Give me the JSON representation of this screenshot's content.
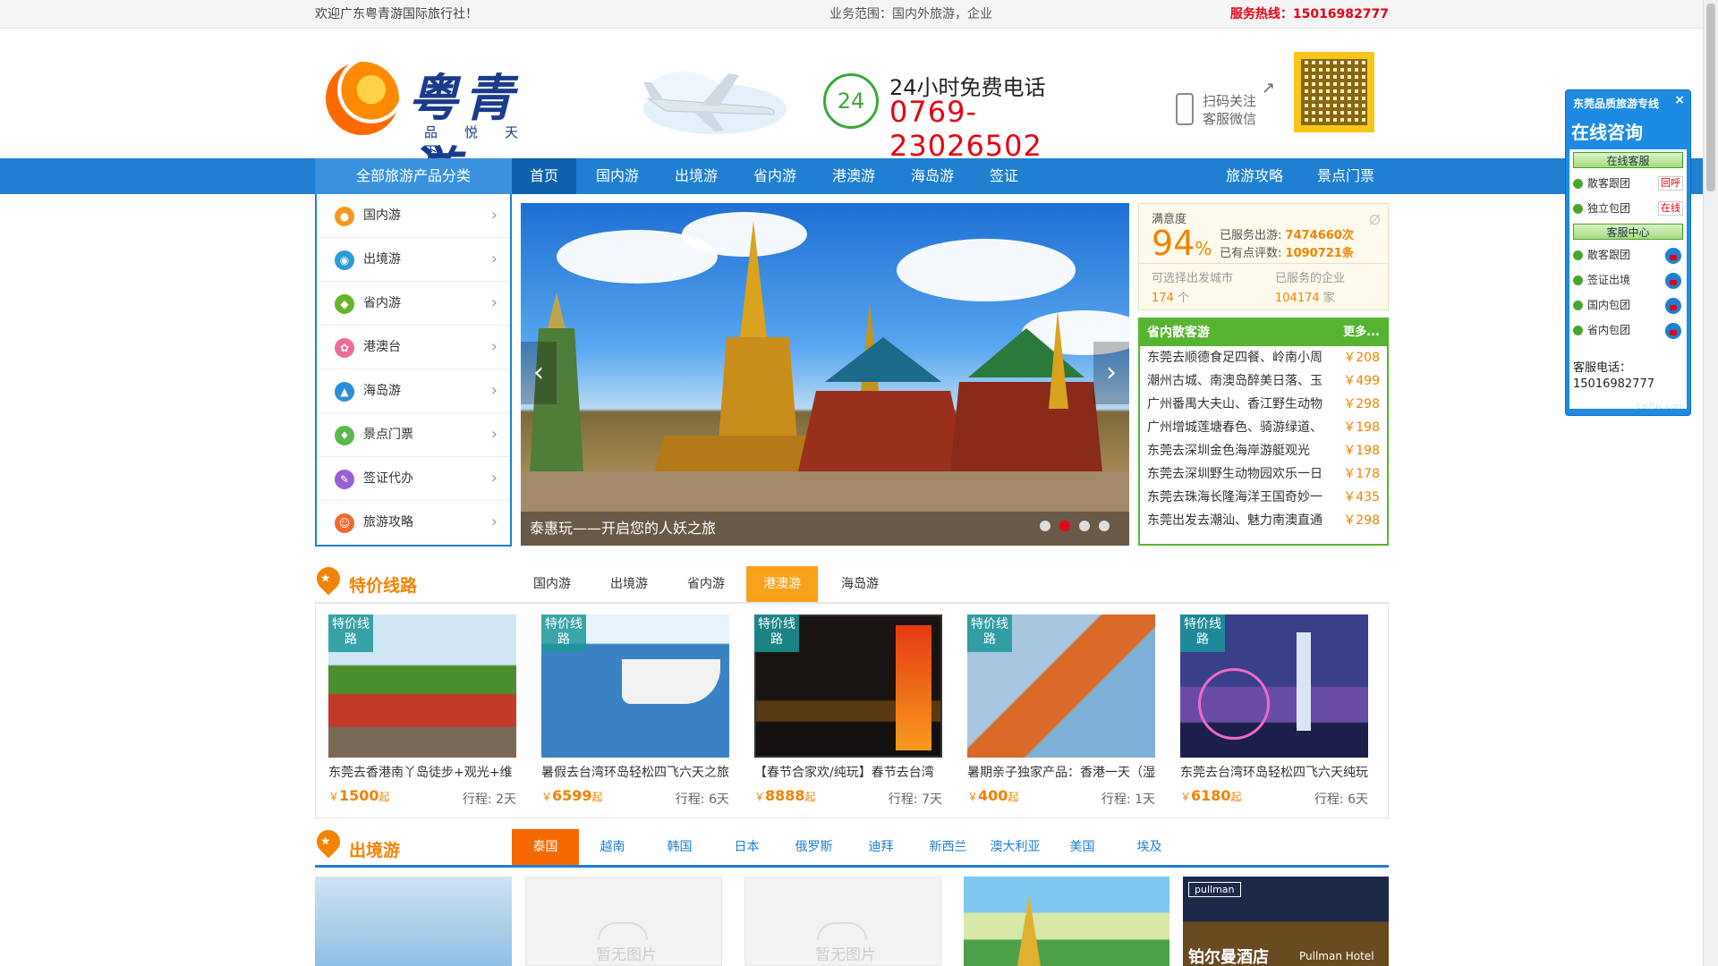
{
  "topbar": {
    "welcome": "欢迎广东粤青游国际旅行社！",
    "scope": "业务范围：国内外旅游，企业",
    "hotline": "服务热线：15016982777"
  },
  "header": {
    "logo_title": "粤青游",
    "logo_slogan": "品悦天下",
    "phone_ring": "24",
    "phone_label": "24小时免费电话",
    "phone_number": "0769-23026502",
    "scan_line1": "扫码关注",
    "scan_line2": "客服微信"
  },
  "nav": {
    "all_label": "全部旅游产品分类",
    "items": [
      {
        "label": "首页",
        "active": true
      },
      {
        "label": "国内游"
      },
      {
        "label": "出境游"
      },
      {
        "label": "省内游"
      },
      {
        "label": "港澳游"
      },
      {
        "label": "海岛游"
      },
      {
        "label": "签证"
      },
      {
        "label": "旅游攻略"
      },
      {
        "label": "景点门票"
      }
    ]
  },
  "categories": [
    {
      "label": "国内游",
      "icon": "domestic-icon",
      "color": "#f39a1e"
    },
    {
      "label": "出境游",
      "icon": "globe-icon",
      "color": "#2d9ad8"
    },
    {
      "label": "省内游",
      "icon": "location-icon",
      "color": "#6ab22d"
    },
    {
      "label": "港澳台",
      "icon": "hk-macau-icon",
      "color": "#f06b9a"
    },
    {
      "label": "海岛游",
      "icon": "island-icon",
      "color": "#2d8ed8"
    },
    {
      "label": "景点门票",
      "icon": "ticket-icon",
      "color": "#5bb84a"
    },
    {
      "label": "签证代办",
      "icon": "visa-icon",
      "color": "#9a5fd0"
    },
    {
      "label": "旅游攻略",
      "icon": "guide-icon",
      "color": "#f26a2d"
    }
  ],
  "banner": {
    "caption": "泰惠玩——开启您的人妖之旅",
    "prev": "‹",
    "next": "›",
    "dots": 4,
    "active_dot": 1
  },
  "stats": {
    "satisfaction_label": "满意度",
    "satisfaction_value": "94",
    "satisfaction_unit": "%",
    "served_label": "已服务出游:",
    "served_value": "7474660次",
    "reviews_label": "已有点评数:",
    "reviews_value": "1090721条",
    "cities_label": "可选择出发城市",
    "cities_value": "174",
    "cities_unit": "个",
    "companies_label": "已服务的企业",
    "companies_value": "104174",
    "companies_unit": "家"
  },
  "province_tours": {
    "title": "省内散客游",
    "more": "更多...",
    "items": [
      {
        "title": "东莞去顺德食足四餐、岭南小周",
        "price": "￥208"
      },
      {
        "title": "潮州古城、南澳岛醉美日落、玉",
        "price": "￥499"
      },
      {
        "title": "广州番禺大夫山、香江野生动物",
        "price": "￥298"
      },
      {
        "title": "广州增城莲塘春色、骑游绿道、",
        "price": "￥198"
      },
      {
        "title": "东莞去深圳金色海岸游艇观光",
        "price": "￥198"
      },
      {
        "title": "东莞去深圳野生动物园欢乐一日",
        "price": "￥178"
      },
      {
        "title": "东莞去珠海长隆海洋王国奇妙一",
        "price": "￥435"
      },
      {
        "title": "东莞出发去潮汕、魅力南澳直通",
        "price": "￥298"
      }
    ]
  },
  "special": {
    "title": "特价线路",
    "tabs": [
      {
        "label": "国内游"
      },
      {
        "label": "出境游"
      },
      {
        "label": "省内游"
      },
      {
        "label": "港澳游",
        "active": true
      },
      {
        "label": "海岛游"
      }
    ],
    "tag": "特价线路",
    "cards": [
      {
        "name": "东莞去香港南丫岛徒步+观光+维",
        "price": "1500",
        "days": "行程: 2天"
      },
      {
        "name": "暑假去台湾环岛轻松四飞六天之旅",
        "price": "6599",
        "days": "行程: 6天"
      },
      {
        "name": "【春节合家欢/纯玩】春节去台湾",
        "price": "8888",
        "days": "行程: 7天"
      },
      {
        "name": "暑期亲子独家产品：香港一天（湿",
        "price": "400",
        "days": "行程: 1天"
      },
      {
        "name": "东莞去台湾环岛轻松四飞六天纯玩",
        "price": "6180",
        "days": "行程: 6天"
      }
    ],
    "currency": "￥",
    "price_suffix": "起"
  },
  "outbound": {
    "title": "出境游",
    "tabs": [
      {
        "label": "泰国",
        "active": true
      },
      {
        "label": "越南"
      },
      {
        "label": "韩国"
      },
      {
        "label": "日本"
      },
      {
        "label": "俄罗斯"
      },
      {
        "label": "迪拜"
      },
      {
        "label": "新西兰"
      },
      {
        "label": "澳大利亚"
      },
      {
        "label": "美国"
      },
      {
        "label": "埃及"
      }
    ],
    "no_image": "暂无图片",
    "hotel_text": "铂尔曼酒店",
    "hotel_brand": "pullman",
    "hotel_en": "Pullman Hotel"
  },
  "service": {
    "header": "东莞品质旅游专线",
    "close": "×",
    "title": "在线咨询",
    "online_btn": "在线客服",
    "rows1": [
      {
        "label": "散客跟团",
        "badge": "回呼"
      },
      {
        "label": "独立包团",
        "badge": "在线"
      }
    ],
    "center_btn": "客服中心",
    "rows2": [
      {
        "label": "散客跟团"
      },
      {
        "label": "签证出境"
      },
      {
        "label": "国内包团"
      },
      {
        "label": "省内包团"
      }
    ],
    "tel_label": "客服电话：",
    "tel": "15016982777",
    "footer": "caifuc.com"
  }
}
